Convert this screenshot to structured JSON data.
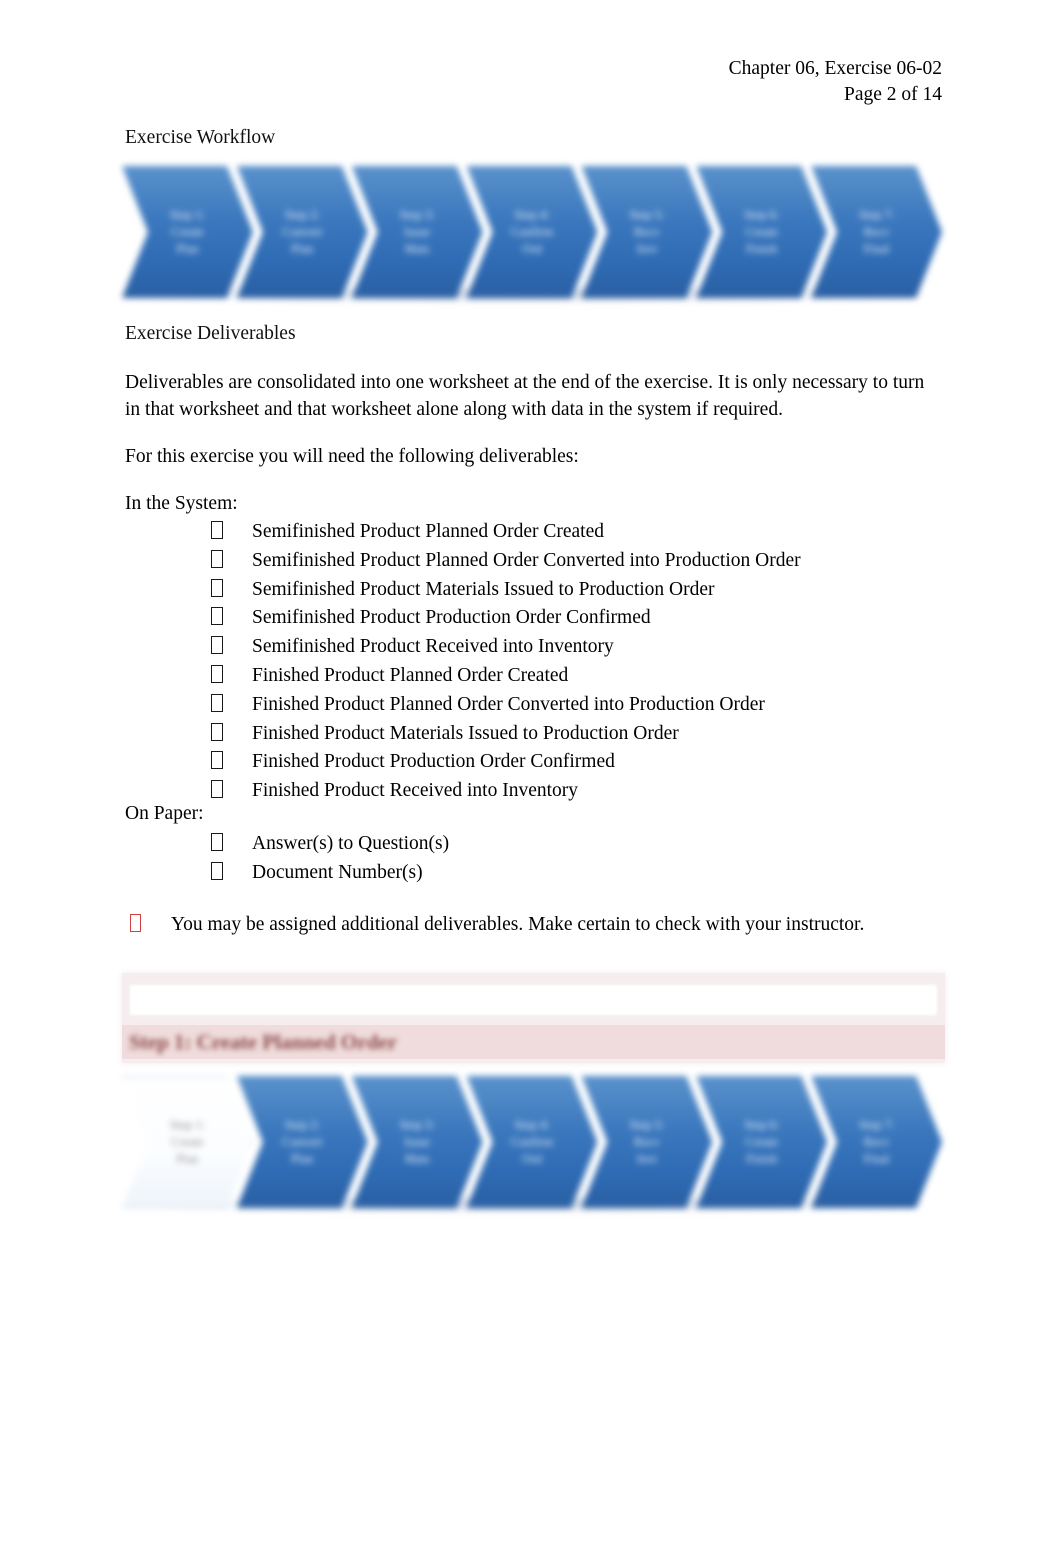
{
  "header": {
    "line1": "Chapter 06, Exercise 06-02",
    "line2": "Page 2 of 14"
  },
  "headings": {
    "workflow": "Exercise Workflow",
    "deliverables": "Exercise Deliverables"
  },
  "paragraphs": {
    "intro": "Deliverables are consolidated into one worksheet at the end of the exercise. It is only necessary to turn in that worksheet and that worksheet alone along with data in the system if required.",
    "for_this_exercise": "For this exercise you will need the following deliverables:",
    "in_the_system_label": "In the System:",
    "on_paper_label": "On Paper:"
  },
  "system_deliverables": [
    "Semifinished Product Planned Order Created",
    "Semifinished Product Planned Order Converted into Production Order",
    "Semifinished Product Materials Issued to Production Order",
    "Semifinished Product Production Order Confirmed",
    "Semifinished Product Received into Inventory",
    "Finished Product Planned Order Created",
    "Finished Product Planned Order Converted into Production Order",
    "Finished Product Materials Issued to Production Order",
    "Finished Product Production Order Confirmed",
    "Finished Product Received into Inventory"
  ],
  "paper_deliverables": [
    "Answer(s) to Question(s)",
    "Document Number(s)"
  ],
  "note": {
    "text": "You may be assigned additional deliverables. Make certain to check with your instructor."
  },
  "step_banner": {
    "title": "Step 1: Create Planned Order"
  },
  "workflow_top": {
    "steps": [
      {
        "lines": [
          "Step 1:",
          "Create",
          "Plan"
        ]
      },
      {
        "lines": [
          "Step 2:",
          "Convert",
          "Plan"
        ]
      },
      {
        "lines": [
          "Step 3:",
          "Issue",
          "Mats"
        ]
      },
      {
        "lines": [
          "Step 4:",
          "Confirm",
          "Ord"
        ]
      },
      {
        "lines": [
          "Step 5:",
          "Recv",
          "Invt"
        ]
      },
      {
        "lines": [
          "Step 6:",
          "Create",
          "Finish"
        ]
      },
      {
        "lines": [
          "Step 7:",
          "Recv",
          "Final"
        ]
      }
    ]
  },
  "workflow_bottom": {
    "active_index": 0,
    "steps": [
      {
        "lines": [
          "Step 1:",
          "Create",
          "Plan"
        ]
      },
      {
        "lines": [
          "Step 2:",
          "Convert",
          "Plan"
        ]
      },
      {
        "lines": [
          "Step 3:",
          "Issue",
          "Mats"
        ]
      },
      {
        "lines": [
          "Step 4:",
          "Confirm",
          "Ord"
        ]
      },
      {
        "lines": [
          "Step 5:",
          "Recv",
          "Invt"
        ]
      },
      {
        "lines": [
          "Step 6:",
          "Create",
          "Finish"
        ]
      },
      {
        "lines": [
          "Step 7:",
          "Recv",
          "Final"
        ]
      }
    ]
  },
  "colors": {
    "chevron_blue": "#2f6cb5",
    "chevron_blue_light": "#5a92cc",
    "banner_pink": "#f0dcdc",
    "banner_title": "#8e4b4b",
    "note_red": "#d1403c",
    "text": "#000000"
  }
}
